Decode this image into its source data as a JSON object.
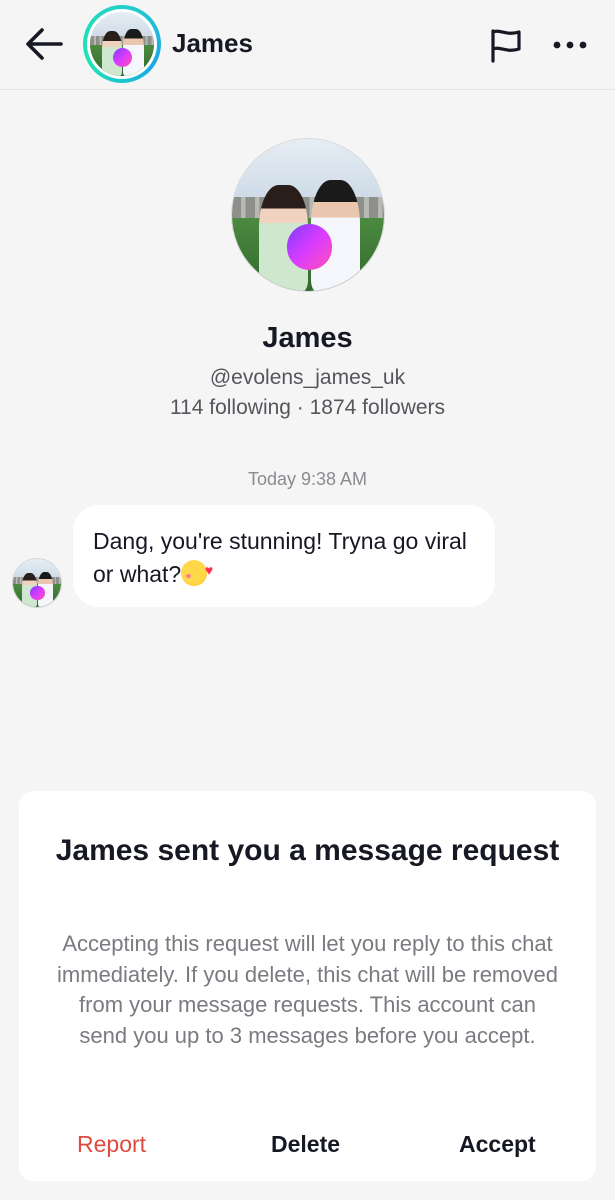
{
  "header": {
    "back_icon": "arrow-left-icon",
    "name": "James",
    "flag_icon": "flag-icon",
    "more_icon": "more-horizontal-icon"
  },
  "profile": {
    "name": "James",
    "handle": "@evolens_james_uk",
    "stats": "114 following · 1874 followers"
  },
  "chat": {
    "timestamp": "Today 9:38 AM",
    "message_text": "Dang, you're stunning! Tryna go viral or what?",
    "message_emoji": "smiling-face-with-hearts"
  },
  "request": {
    "title": "James sent you a message request",
    "body": "Accepting this request will let you reply to this chat immediately. If you delete, this chat will be removed from your message requests. This account can send you up to 3 messages before you accept.",
    "report_label": "Report",
    "delete_label": "Delete",
    "accept_label": "Accept"
  },
  "colors": {
    "report": "#dd4c3f",
    "story_ring": "#25d0c8",
    "background": "#f5f5f5"
  }
}
